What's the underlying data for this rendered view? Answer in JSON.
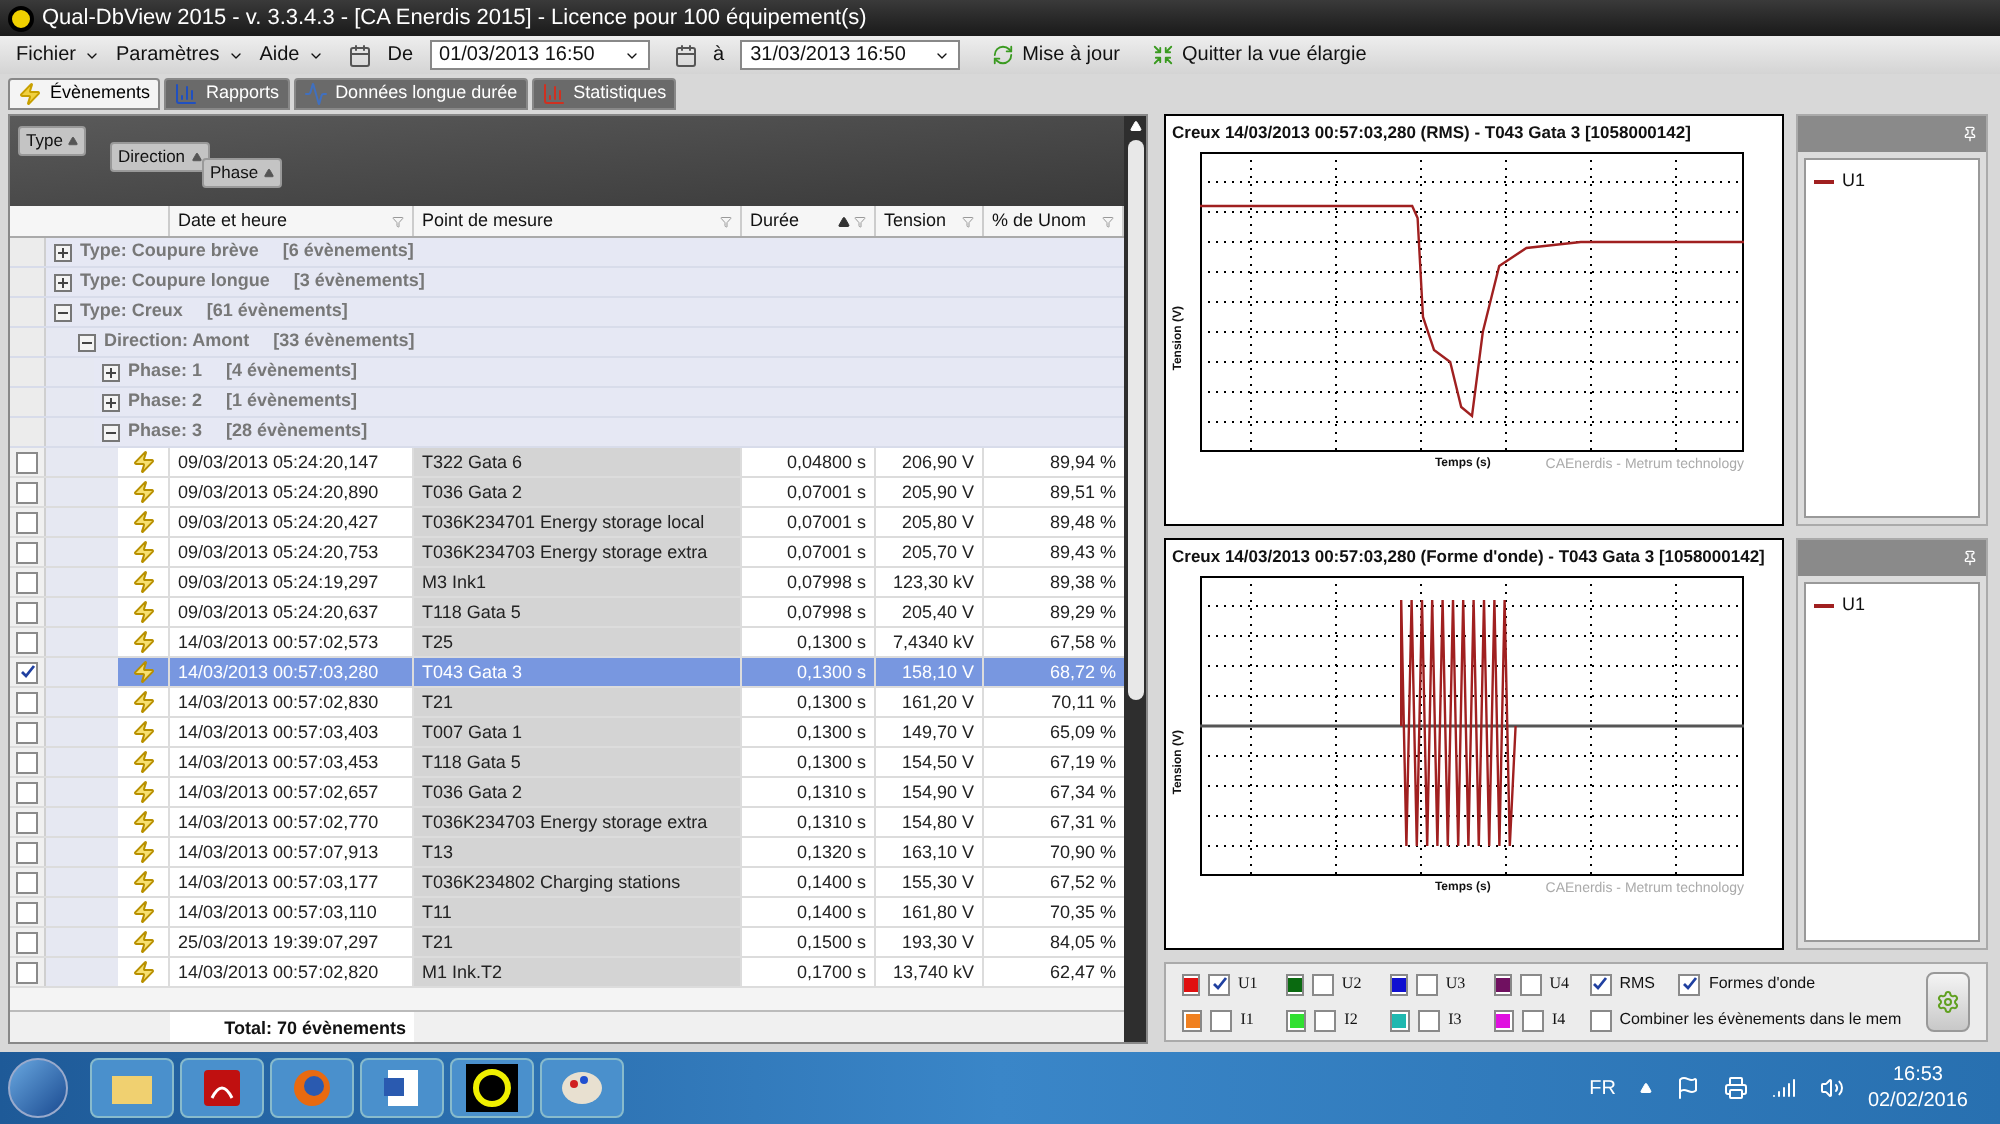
{
  "window": {
    "title": "Qual-DbView 2015 - v. 3.3.4.3 - [CA Enerdis 2015] - Licence pour 100 équipement(s)"
  },
  "menu": [
    "Fichier",
    "Paramètres",
    "Aide"
  ],
  "date_from": {
    "label": "De",
    "value": "01/03/2013 16:50"
  },
  "date_to": {
    "label": "à",
    "value": "31/03/2013 16:50"
  },
  "toolbar_buttons": [
    {
      "kind": "refresh",
      "label": "Mise à jour"
    },
    {
      "kind": "exit",
      "label": "Quitter la vue élargie"
    }
  ],
  "tabs": [
    {
      "kind": "events",
      "label": "Évènements",
      "selected": true
    },
    {
      "kind": "reports",
      "label": "Rapports",
      "selected": false
    },
    {
      "kind": "long",
      "label": "Données longue durée",
      "selected": false
    },
    {
      "kind": "stats",
      "label": "Statistiques",
      "selected": false
    }
  ],
  "group_by": [
    "Type",
    "Direction",
    "Phase"
  ],
  "table": {
    "columns": [
      {
        "label": "Date et heure",
        "sorted": false
      },
      {
        "label": "Point de mesure",
        "sorted": false
      },
      {
        "label": "Durée",
        "sorted": true
      },
      {
        "label": "Tension",
        "sorted": false
      },
      {
        "label": "% de Unom",
        "sorted": false
      }
    ],
    "groups": [
      {
        "label": "Type: Coupure brève",
        "count": "[6 évènements]",
        "expanded": false
      },
      {
        "label": "Type: Coupure longue",
        "count": "[3 évènements]",
        "expanded": false
      },
      {
        "label": "Type: Creux",
        "count": "[61 évènements]",
        "expanded": true,
        "children": [
          {
            "label": "Direction: Amont",
            "count": "[33 évènements]",
            "expanded": true,
            "children": [
              {
                "label": "Phase: 1",
                "count": "[4 évènements]",
                "expanded": false
              },
              {
                "label": "Phase: 2",
                "count": "[1 évènements]",
                "expanded": false
              },
              {
                "label": "Phase: 3",
                "count": "[28 évènements]",
                "expanded": true,
                "rows": [
                  {
                    "checked": false,
                    "selected": false,
                    "cells": [
                      "09/03/2013 05:24:20,147",
                      "T322 Gata 6",
                      "0,04800 s",
                      "206,90 V",
                      "89,94 %"
                    ]
                  },
                  {
                    "checked": false,
                    "selected": false,
                    "cells": [
                      "09/03/2013 05:24:20,890",
                      "T036 Gata 2",
                      "0,07001 s",
                      "205,90 V",
                      "89,51 %"
                    ]
                  },
                  {
                    "checked": false,
                    "selected": false,
                    "cells": [
                      "09/03/2013 05:24:20,427",
                      "T036K234701 Energy storage local",
                      "0,07001 s",
                      "205,80 V",
                      "89,48 %"
                    ]
                  },
                  {
                    "checked": false,
                    "selected": false,
                    "cells": [
                      "09/03/2013 05:24:20,753",
                      "T036K234703 Energy storage extra",
                      "0,07001 s",
                      "205,70 V",
                      "89,43 %"
                    ]
                  },
                  {
                    "checked": false,
                    "selected": false,
                    "cells": [
                      "09/03/2013 05:24:19,297",
                      "M3 Ink1",
                      "0,07998 s",
                      "123,30 kV",
                      "89,38 %"
                    ]
                  },
                  {
                    "checked": false,
                    "selected": false,
                    "cells": [
                      "09/03/2013 05:24:20,637",
                      "T118 Gata 5",
                      "0,07998 s",
                      "205,40 V",
                      "89,29 %"
                    ]
                  },
                  {
                    "checked": false,
                    "selected": false,
                    "cells": [
                      "14/03/2013 00:57:02,573",
                      "T25",
                      "0,1300 s",
                      "7,4340 kV",
                      "67,58 %"
                    ]
                  },
                  {
                    "checked": true,
                    "selected": true,
                    "cells": [
                      "14/03/2013 00:57:03,280",
                      "T043 Gata 3",
                      "0,1300 s",
                      "158,10 V",
                      "68,72 %"
                    ]
                  },
                  {
                    "checked": false,
                    "selected": false,
                    "cells": [
                      "14/03/2013 00:57:02,830",
                      "T21",
                      "0,1300 s",
                      "161,20 V",
                      "70,11 %"
                    ]
                  },
                  {
                    "checked": false,
                    "selected": false,
                    "cells": [
                      "14/03/2013 00:57:03,403",
                      "T007 Gata 1",
                      "0,1300 s",
                      "149,70 V",
                      "65,09 %"
                    ]
                  },
                  {
                    "checked": false,
                    "selected": false,
                    "cells": [
                      "14/03/2013 00:57:03,453",
                      "T118 Gata 5",
                      "0,1300 s",
                      "154,50 V",
                      "67,19 %"
                    ]
                  },
                  {
                    "checked": false,
                    "selected": false,
                    "cells": [
                      "14/03/2013 00:57:02,657",
                      "T036 Gata 2",
                      "0,1310 s",
                      "154,90 V",
                      "67,34 %"
                    ]
                  },
                  {
                    "checked": false,
                    "selected": false,
                    "cells": [
                      "14/03/2013 00:57:02,770",
                      "T036K234703 Energy storage extra",
                      "0,1310 s",
                      "154,80 V",
                      "67,31 %"
                    ]
                  },
                  {
                    "checked": false,
                    "selected": false,
                    "cells": [
                      "14/03/2013 00:57:07,913",
                      "T13",
                      "0,1320 s",
                      "163,10 V",
                      "70,90 %"
                    ]
                  },
                  {
                    "checked": false,
                    "selected": false,
                    "cells": [
                      "14/03/2013 00:57:03,177",
                      "T036K234802 Charging stations",
                      "0,1400 s",
                      "155,30 V",
                      "67,52 %"
                    ]
                  },
                  {
                    "checked": false,
                    "selected": false,
                    "cells": [
                      "14/03/2013 00:57:03,110",
                      "T11",
                      "0,1400 s",
                      "161,80 V",
                      "70,35 %"
                    ]
                  },
                  {
                    "checked": false,
                    "selected": false,
                    "cells": [
                      "25/03/2013 19:39:07,297",
                      "T21",
                      "0,1500 s",
                      "193,30 V",
                      "84,05 %"
                    ]
                  },
                  {
                    "checked": false,
                    "selected": false,
                    "cells": [
                      "14/03/2013 00:57:02,820",
                      "M1 Ink.T2",
                      "0,1700 s",
                      "13,740 kV",
                      "62,47 %"
                    ]
                  }
                ]
              }
            ]
          }
        ]
      }
    ],
    "total": "Total: 70 évènements"
  },
  "charts": [
    {
      "kind": "rms",
      "title": "Creux 14/03/2013 00:57:03,280 (RMS)   - T043 Gata 3 [1058000142]",
      "xlabel": "Temps (s)",
      "ylabel": "Tension (V)",
      "credit": "CAEnerdis - Metrum technology",
      "legend": [
        {
          "label": "U1",
          "color": "#a02020"
        }
      ]
    },
    {
      "kind": "wave",
      "title": "Creux 14/03/2013 00:57:03,280 (Forme d'onde)   - T043 Gata 3 [1058000142]",
      "xlabel": "Temps (s)",
      "ylabel": "Tension (V)",
      "credit": "CAEnerdis - Metrum technology",
      "legend": [
        {
          "label": "U1",
          "color": "#a02020"
        }
      ]
    }
  ],
  "channels": [
    {
      "label": "U1",
      "color": "#e01010",
      "checked": true
    },
    {
      "label": "U2",
      "color": "#0a6a10",
      "checked": false
    },
    {
      "label": "U3",
      "color": "#1010d0",
      "checked": false
    },
    {
      "label": "U4",
      "color": "#701060",
      "checked": false
    },
    {
      "label": "I1",
      "color": "#f08020",
      "checked": false
    },
    {
      "label": "I2",
      "color": "#30e030",
      "checked": false
    },
    {
      "label": "I3",
      "color": "#20b8b0",
      "checked": false
    },
    {
      "label": "I4",
      "color": "#e010e0",
      "checked": false
    }
  ],
  "options": [
    {
      "label": "RMS",
      "checked": true
    },
    {
      "label": "Formes d'onde",
      "checked": true
    },
    {
      "label": "Combiner les évènements dans le mem",
      "checked": false
    }
  ],
  "taskbar": {
    "language": "FR",
    "time": "16:53",
    "date": "02/02/2016"
  }
}
